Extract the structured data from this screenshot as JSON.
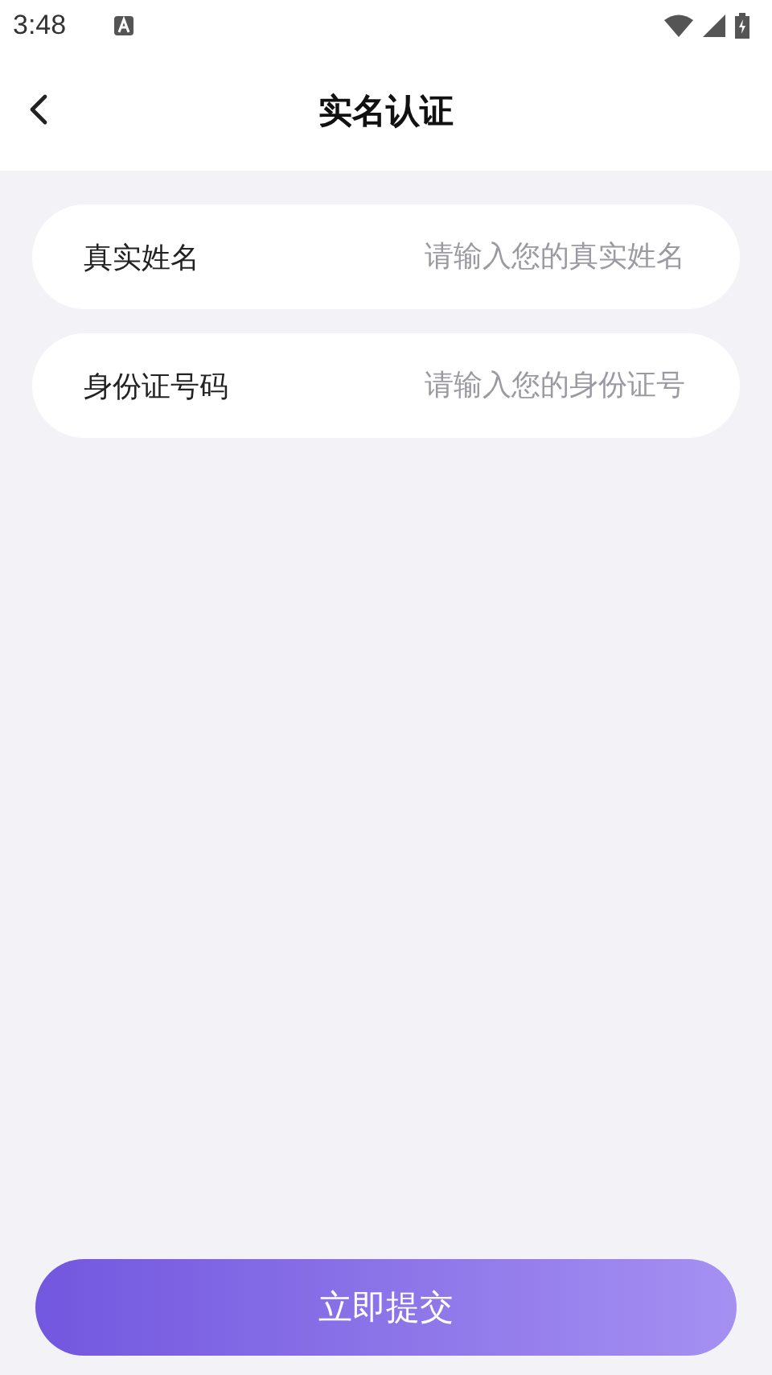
{
  "status_bar": {
    "time": "3:48"
  },
  "header": {
    "title": "实名认证"
  },
  "fields": [
    {
      "label": "真实姓名",
      "placeholder": "请输入您的真实姓名"
    },
    {
      "label": "身份证号码",
      "placeholder": "请输入您的身份证号"
    }
  ],
  "submit_button": {
    "label": "立即提交"
  }
}
